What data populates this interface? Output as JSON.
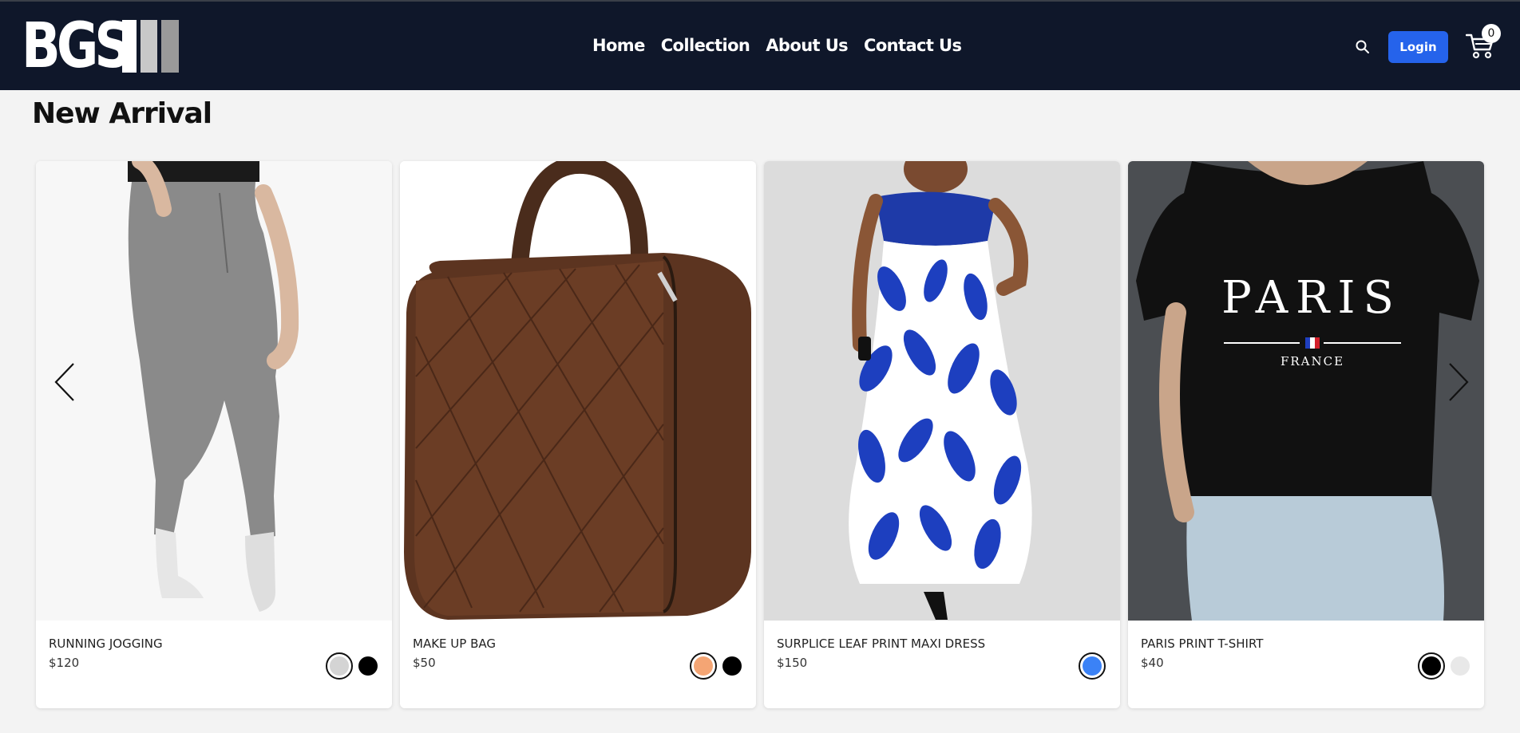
{
  "brand": {
    "logo_text": "BGS"
  },
  "nav": {
    "items": [
      "Home",
      "Collection",
      "About Us",
      "Contact Us"
    ]
  },
  "header": {
    "login_label": "Login",
    "cart_count": "0",
    "icons": [
      "search-icon",
      "cart-icon"
    ]
  },
  "section": {
    "title": "New Arrival"
  },
  "colors": {
    "header_bg": "#0f172a",
    "login_bg": "#2563eb",
    "page_bg": "#f3f3f3"
  },
  "products": [
    {
      "name": "RUNNING JOGGING",
      "price": "$120",
      "colors": [
        "#d4d4d4",
        "#000000"
      ],
      "selected": 0
    },
    {
      "name": "MAKE UP BAG",
      "price": "$50",
      "colors": [
        "#f4a574",
        "#000000"
      ],
      "selected": 0
    },
    {
      "name": "SURPLICE LEAF PRINT MAXI DRESS",
      "price": "$150",
      "colors": [
        "#3b82f6"
      ],
      "selected": 0
    },
    {
      "name": "PARIS PRINT T-SHIRT",
      "price": "$40",
      "colors": [
        "#000000",
        "#e5e5e5"
      ],
      "selected": 0
    }
  ],
  "tshirt_print": {
    "word": "PARIS",
    "country": "FRANCE"
  },
  "carousel": {
    "prev_icon": "chevron-left-icon",
    "next_icon": "chevron-right-icon"
  }
}
